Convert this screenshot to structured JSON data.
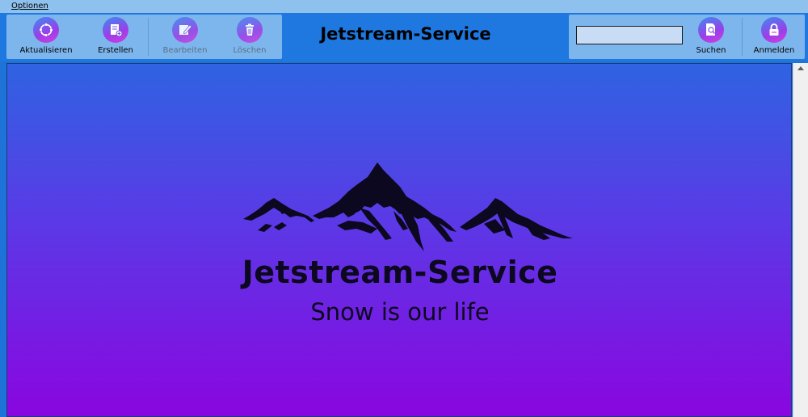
{
  "menu": {
    "optionen": "Optionen"
  },
  "toolbar": {
    "refresh_label": "Aktualisieren",
    "create_label": "Erstellen",
    "edit_label": "Bearbeiten",
    "delete_label": "Löschen",
    "search_label": "Suchen",
    "login_label": "Anmelden"
  },
  "header": {
    "title": "Jetstream-Service"
  },
  "search": {
    "value": ""
  },
  "content": {
    "brand_name": "Jetstream-Service",
    "tagline": "Snow is our life"
  },
  "icons": {
    "refresh": "refresh-icon",
    "create": "create-document-icon",
    "edit": "edit-icon",
    "delete": "trash-icon",
    "search": "search-document-icon",
    "login": "lock-icon"
  },
  "colors": {
    "header_bg": "#1e78e0",
    "panel_bg": "#7db6ec",
    "menubar_bg": "#8fc1ee",
    "gradient_top": "#2f63e2",
    "gradient_bottom": "#8a06e0",
    "text_dark": "#0b0820"
  }
}
